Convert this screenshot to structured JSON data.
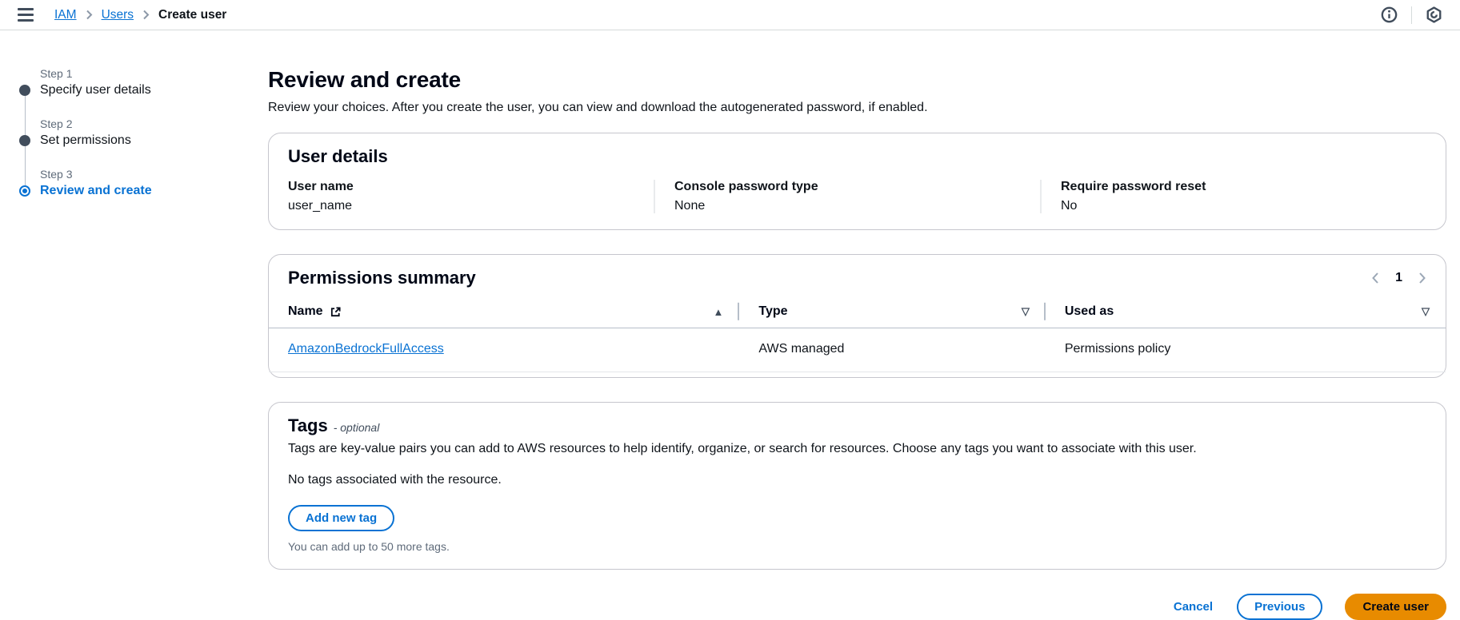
{
  "topbar": {
    "breadcrumb": {
      "items": [
        {
          "label": "IAM"
        },
        {
          "label": "Users"
        },
        {
          "label": "Create user"
        }
      ]
    }
  },
  "steps": [
    {
      "step": "Step 1",
      "title": "Specify user details",
      "state": "visited"
    },
    {
      "step": "Step 2",
      "title": "Set permissions",
      "state": "visited"
    },
    {
      "step": "Step 3",
      "title": "Review and create",
      "state": "active"
    }
  ],
  "page": {
    "title": "Review and create",
    "description": "Review your choices. After you create the user, you can view and download the autogenerated password, if enabled."
  },
  "user_details": {
    "title": "User details",
    "fields": [
      {
        "label": "User name",
        "value": "user_name"
      },
      {
        "label": "Console password type",
        "value": "None"
      },
      {
        "label": "Require password reset",
        "value": "No"
      }
    ]
  },
  "permissions": {
    "title": "Permissions summary",
    "pagination": {
      "current_page": "1"
    },
    "columns": [
      {
        "label": "Name",
        "sort": "▲"
      },
      {
        "label": "Type",
        "sort": "▽"
      },
      {
        "label": "Used as",
        "sort": "▽"
      }
    ],
    "rows": [
      {
        "name": "AmazonBedrockFullAccess",
        "type": "AWS managed",
        "used_as": "Permissions policy"
      }
    ]
  },
  "tags": {
    "title": "Tags",
    "optional": "- optional",
    "description": "Tags are key-value pairs you can add to AWS resources to help identify, organize, or search for resources. Choose any tags you want to associate with this user.",
    "empty": "No tags associated with the resource.",
    "add_button": "Add new tag",
    "limit": "You can add up to 50 more tags."
  },
  "footer": {
    "cancel": "Cancel",
    "previous": "Previous",
    "create": "Create user"
  },
  "colors": {
    "link": "#0972d3",
    "primary_button_bg": "#e88b00",
    "primary_button_text": "#000716",
    "step_bullet": "#414d5c"
  }
}
